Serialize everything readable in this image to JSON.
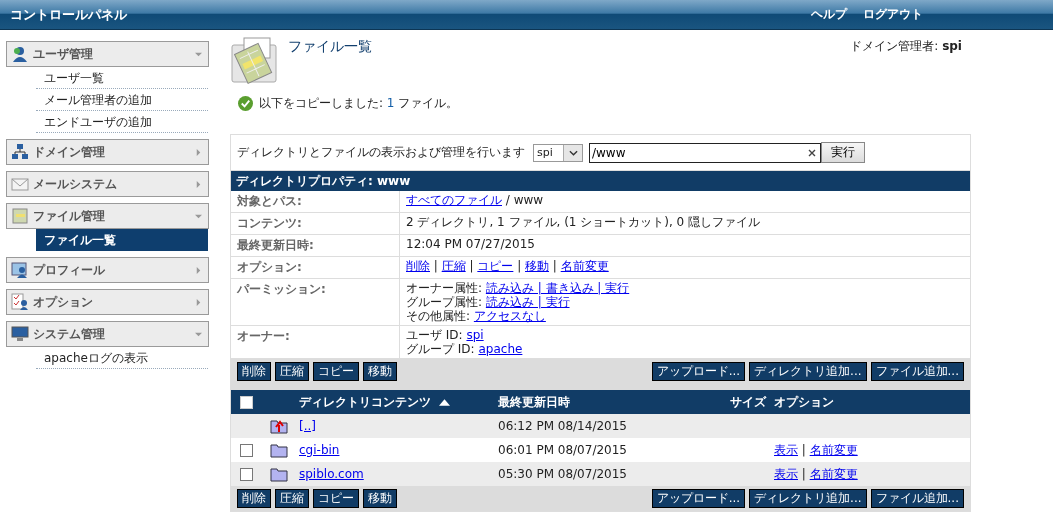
{
  "header": {
    "title": "コントロールパネル",
    "links": [
      "ヘルプ",
      "ログアウト"
    ]
  },
  "sidebar": {
    "groups": [
      {
        "label": "ユーザ管理",
        "kind": "user",
        "expanded": true,
        "items": [
          {
            "label": "ユーザ一覧",
            "selected": false
          },
          {
            "label": "メール管理者の追加",
            "selected": false
          },
          {
            "label": "エンドユーザの追加",
            "selected": false
          }
        ]
      },
      {
        "label": "ドメイン管理",
        "kind": "network",
        "expanded": false
      },
      {
        "label": "メールシステム",
        "kind": "mail",
        "expanded": false
      },
      {
        "label": "ファイル管理",
        "kind": "file",
        "expanded": true,
        "items": [
          {
            "label": "ファイル一覧",
            "selected": true
          }
        ]
      },
      {
        "label": "プロフィール",
        "kind": "profile",
        "expanded": false
      },
      {
        "label": "オプション",
        "kind": "options",
        "expanded": false
      },
      {
        "label": "システム管理",
        "kind": "system",
        "expanded": true,
        "items": [
          {
            "label": "apacheログの表示",
            "selected": false
          }
        ]
      }
    ]
  },
  "page": {
    "title": "ファイル一覧",
    "admin_label": "ドメイン管理者:",
    "admin_name": "spi"
  },
  "message": {
    "before": "以下をコピーしました:",
    "count": "1",
    "after": "ファイル。"
  },
  "browse": {
    "label": "ディレクトリとファイルの表示および管理を行います",
    "owner": "spi",
    "path": "/www",
    "submit": "実行"
  },
  "properties": {
    "title": "ディレクトリプロパティ: www",
    "rows": [
      {
        "label": "対象とパス:",
        "lines": [
          [
            {
              "kind": "link",
              "text": "すべてのファイル"
            },
            {
              "kind": "text",
              "text": " / www"
            }
          ]
        ]
      },
      {
        "label": "コンテンツ:",
        "lines": [
          [
            {
              "kind": "text",
              "text": "2 ディレクトリ, 1 ファイル, (1 ショートカット), 0 隠しファイル"
            }
          ]
        ]
      },
      {
        "label": "最終更新日時:",
        "lines": [
          [
            {
              "kind": "text",
              "text": "12:04 PM 07/27/2015"
            }
          ]
        ]
      },
      {
        "label": "オプション:",
        "lines": [
          [
            {
              "kind": "link",
              "text": "削除"
            },
            {
              "kind": "text",
              "text": " | "
            },
            {
              "kind": "link",
              "text": "圧縮"
            },
            {
              "kind": "text",
              "text": " | "
            },
            {
              "kind": "link",
              "text": "コピー"
            },
            {
              "kind": "text",
              "text": " | "
            },
            {
              "kind": "link",
              "text": "移動"
            },
            {
              "kind": "text",
              "text": " | "
            },
            {
              "kind": "link",
              "text": "名前変更"
            }
          ]
        ]
      },
      {
        "label": "パーミッション:",
        "lines": [
          [
            {
              "kind": "text",
              "text": "オーナー属性: "
            },
            {
              "kind": "link",
              "text": "読み込み | 書き込み | 実行"
            }
          ],
          [
            {
              "kind": "text",
              "text": "グループ属性: "
            },
            {
              "kind": "link",
              "text": "読み込み | 実行"
            }
          ],
          [
            {
              "kind": "text",
              "text": "その他属性: "
            },
            {
              "kind": "link",
              "text": "アクセスなし"
            }
          ]
        ]
      },
      {
        "label": "オーナー:",
        "lines": [
          [
            {
              "kind": "text",
              "text": "ユーザ ID: "
            },
            {
              "kind": "link",
              "text": "spi"
            }
          ],
          [
            {
              "kind": "text",
              "text": "グループ ID: "
            },
            {
              "kind": "link",
              "text": "apache"
            }
          ]
        ]
      }
    ]
  },
  "toolbars": [
    {
      "left": [
        "削除",
        "圧縮",
        "コピー",
        "移動"
      ],
      "right": [
        "アップロード...",
        "ディレクトリ追加...",
        "ファイル追加..."
      ]
    },
    {
      "left": [
        "削除",
        "圧縮",
        "コピー",
        "移動"
      ],
      "right": [
        "アップロード...",
        "ディレクトリ追加...",
        "ファイル追加..."
      ]
    }
  ],
  "files": {
    "select_all": false,
    "columns": [
      "ディレクトリコンテンツ",
      "最終更新日時",
      "サイズ",
      "オプション"
    ],
    "rows": [
      {
        "kind": "parent",
        "name": "[..]",
        "modified": "06:12 PM 08/14/2015"
      },
      {
        "kind": "folder",
        "checked": false,
        "name": "cgi-bin",
        "modified": "06:01 PM 08/07/2015",
        "options": [
          {
            "kind": "link",
            "text": "表示"
          },
          {
            "kind": "text",
            "text": " | "
          },
          {
            "kind": "link",
            "text": "名前変更"
          }
        ]
      },
      {
        "kind": "folder",
        "checked": false,
        "name": "spiblo.com",
        "modified": "05:30 PM 08/07/2015",
        "options": [
          {
            "kind": "link",
            "text": "表示"
          },
          {
            "kind": "text",
            "text": " | "
          },
          {
            "kind": "link",
            "text": "名前変更"
          }
        ]
      }
    ]
  }
}
